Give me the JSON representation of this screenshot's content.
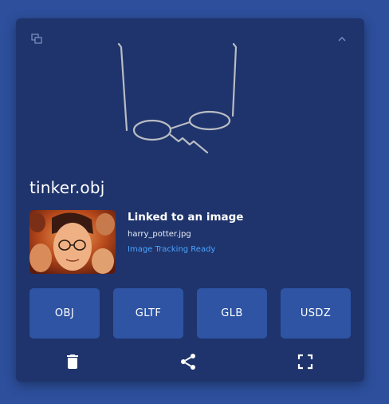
{
  "card": {
    "file_name": "tinker.obj",
    "link": {
      "title": "Linked to an image",
      "file": "harry_potter.jpg",
      "status": "Image Tracking Ready"
    },
    "formats": [
      "OBJ",
      "GLTF",
      "GLB",
      "USDZ"
    ],
    "icons": {
      "top_left": "copy-icon",
      "top_right": "chevron-up-icon",
      "actions": [
        "trash-icon",
        "share-icon",
        "fullscreen-icon"
      ]
    },
    "colors": {
      "background": "#2d4f9c",
      "card": "#1f346c",
      "button": "#2e54a3",
      "status": "#4aa3ff"
    }
  }
}
